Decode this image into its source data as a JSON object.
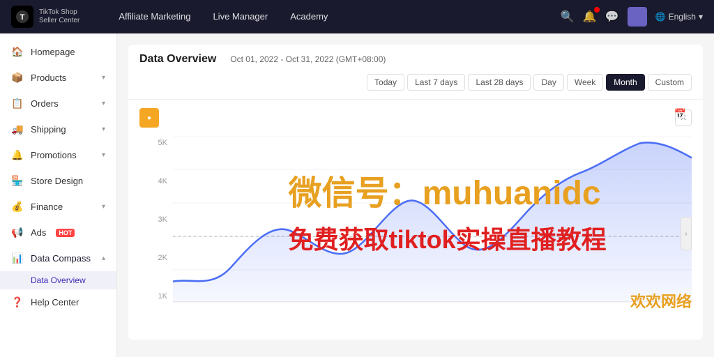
{
  "topnav": {
    "logo_line1": "TikTok Shop",
    "logo_line2": "Seller Center",
    "nav_links": [
      {
        "label": "Affiliate Marketing",
        "active": false
      },
      {
        "label": "Live Manager",
        "active": false
      },
      {
        "label": "Academy",
        "active": false
      }
    ],
    "lang_label": "English"
  },
  "sidebar": {
    "items": [
      {
        "id": "homepage",
        "label": "Homepage",
        "icon": "🏠",
        "has_arrow": false,
        "active": false
      },
      {
        "id": "products",
        "label": "Products",
        "icon": "📦",
        "has_arrow": true,
        "active": false
      },
      {
        "id": "orders",
        "label": "Orders",
        "icon": "📋",
        "has_arrow": true,
        "active": false
      },
      {
        "id": "shipping",
        "label": "Shipping",
        "icon": "🚚",
        "has_arrow": true,
        "active": false
      },
      {
        "id": "promotions",
        "label": "Promotions",
        "icon": "🔔",
        "has_arrow": true,
        "active": false
      },
      {
        "id": "store-design",
        "label": "Store Design",
        "icon": "🏪",
        "has_arrow": false,
        "active": false
      },
      {
        "id": "finance",
        "label": "Finance",
        "icon": "💰",
        "has_arrow": true,
        "active": false
      },
      {
        "id": "ads",
        "label": "Ads",
        "icon": "📢",
        "has_arrow": false,
        "hot": true,
        "active": false
      },
      {
        "id": "data-compass",
        "label": "Data Compass",
        "icon": "📊",
        "has_arrow": true,
        "active": true,
        "expanded": true
      },
      {
        "id": "help-center",
        "label": "Help Center",
        "icon": "❓",
        "has_arrow": false,
        "active": false
      }
    ],
    "data_compass_sub": [
      {
        "id": "data-overview",
        "label": "Data Overview",
        "active": true
      }
    ]
  },
  "content": {
    "title": "Data Overview",
    "date_range": "Oct 01, 2022 - Oct 31, 2022 (GMT+08:00)",
    "filter_buttons": [
      {
        "label": "Today",
        "active": false
      },
      {
        "label": "Last 7 days",
        "active": false
      },
      {
        "label": "Last 28 days",
        "active": false
      },
      {
        "label": "Day",
        "active": false
      },
      {
        "label": "Week",
        "active": false
      },
      {
        "label": "Month",
        "active": true
      },
      {
        "label": "Custom",
        "active": false
      }
    ],
    "chart": {
      "y_labels": [
        "5K",
        "4K",
        "3K",
        "2K",
        "1K"
      ],
      "watermark1": "微信号：muhuanidc",
      "watermark2": "免费获取tiktok实操直播教程",
      "watermark3": "欢欢网络"
    }
  }
}
